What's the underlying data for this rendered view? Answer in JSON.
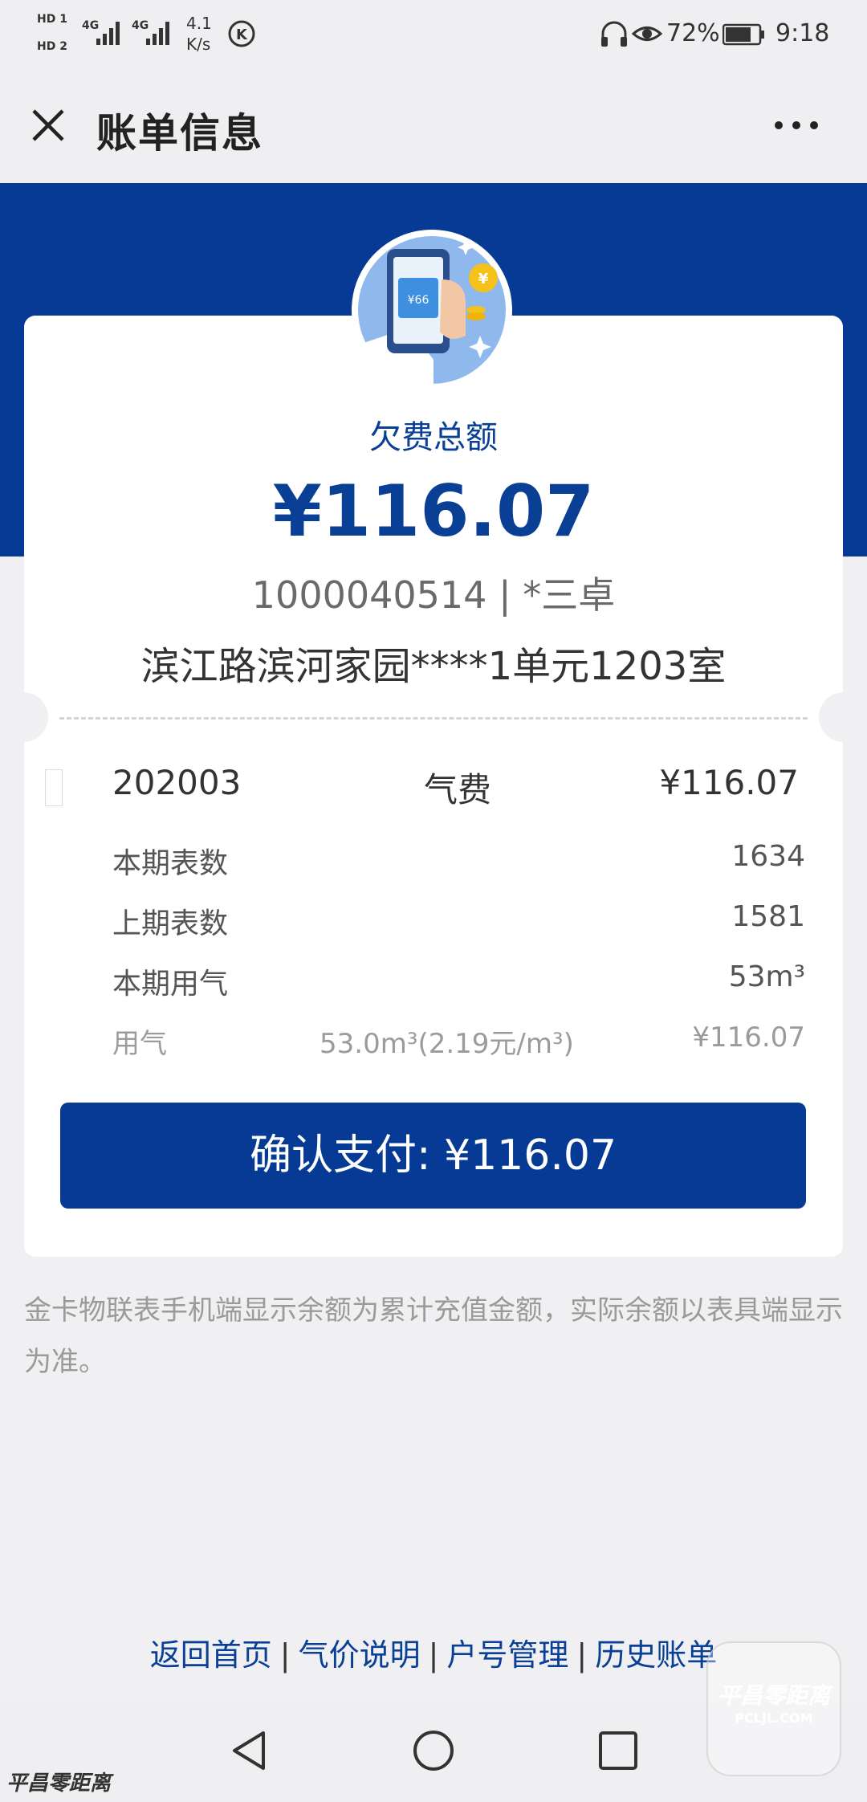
{
  "status_bar": {
    "sim1": "HD 1",
    "sim2": "HD 2",
    "net1": "4G",
    "net2": "4G",
    "speed_value": "4.1",
    "speed_unit": "K/s",
    "battery": "72%",
    "time": "9:18"
  },
  "nav": {
    "title": "账单信息",
    "close_icon": "close-icon",
    "more_icon": "more-icon"
  },
  "summary": {
    "label": "欠费总额",
    "amount": "¥116.07",
    "account": "1000040514 | *三卓",
    "address": "滨江路滨河家园****1单元1203室"
  },
  "bill": {
    "period": "202003",
    "type": "气费",
    "amount": "¥116.07",
    "rows": [
      {
        "label": "本期表数",
        "value": "1634"
      },
      {
        "label": "上期表数",
        "value": "1581"
      },
      {
        "label": "本期用气",
        "value": "53m³"
      }
    ],
    "usage": {
      "label": "用气",
      "detail": "53.0m³(2.19元/m³)",
      "amount": "¥116.07"
    }
  },
  "pay_button": "确认支付: ¥116.07",
  "note": "金卡物联表手机端显示余额为累计充值金额，实际余额以表具端显示为准。",
  "footer_links": [
    "返回首页",
    "气价说明",
    "户号管理",
    "历史账单"
  ],
  "footer_separator": "|",
  "watermark": {
    "bottom_left": "平昌零距离",
    "logo_text": "平昌零距离",
    "logo_sub": "PCLJL.COM"
  },
  "colors": {
    "brand_blue": "#063a94",
    "text_blue": "#0a3f96",
    "background": "#f0f0f2"
  }
}
